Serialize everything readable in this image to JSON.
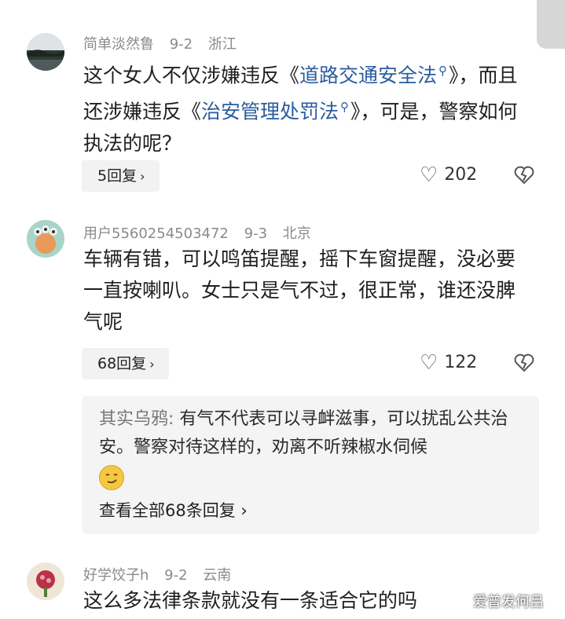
{
  "comments": [
    {
      "username": "简单淡然鲁",
      "date": "9-2",
      "location": "浙江",
      "text_part1": "这个女人不仅涉嫌违反《",
      "link1": "道路交通安全法",
      "text_part2": "》，而且还涉嫌违反《",
      "link2": "治安管理处罚法",
      "text_part3": "》，可是，警察如何执法的呢？",
      "reply_label": "5回复",
      "likes": "202"
    },
    {
      "username": "用户5560254503472",
      "date": "9-3",
      "location": "北京",
      "text": "车辆有错，可以鸣笛提醒，摇下车窗提醒，没必要一直按喇叭。女士只是气不过，很正常，谁还没脾气呢",
      "reply_label": "68回复",
      "likes": "122",
      "sub_reply": {
        "username": "其实乌鸦:",
        "text": "有气不代表可以寻衅滋事，可以扰乱公共治安。警察对待这样的，劝离不听辣椒水伺候",
        "view_all": "查看全部68条回复"
      }
    },
    {
      "username": "好学饺子h",
      "date": "9-2",
      "location": "云南",
      "text": "这么多法律条款就没有一条适合它的吗"
    }
  ],
  "icons": {
    "search": "search-icon",
    "like": "heart-outline-icon",
    "dislike": "broken-heart-icon",
    "chevron": "chevron-right-icon"
  },
  "watermark": "爱普发何吕",
  "colors": {
    "link": "#2a5d9f",
    "meta": "#8a8a8a",
    "reply_bg": "#f2f2f2"
  }
}
